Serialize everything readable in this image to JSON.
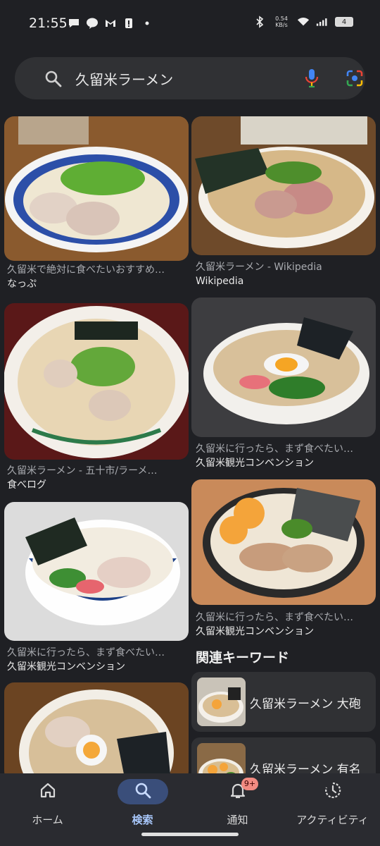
{
  "status": {
    "time": "21:55",
    "net_speed_value": "0.54",
    "net_speed_unit": "KB/s",
    "battery": "4",
    "left_icons": [
      "chat-icon",
      "line-icon",
      "gmail-icon",
      "alert-icon",
      "dot-icon"
    ],
    "right_icons": [
      "bluetooth-icon",
      "wifi-icon",
      "signal-icon",
      "battery-icon"
    ]
  },
  "search": {
    "query": "久留米ラーメン"
  },
  "results": [
    {
      "title": "久留米で絶対に食べたいおすすめ…",
      "source": "なっぷ"
    },
    {
      "title": "久留米ラーメン - Wikipedia",
      "source": "Wikipedia"
    },
    {
      "title": "久留米ラーメン - 五十市/ラーメ…",
      "source": "食べログ"
    },
    {
      "title": "久留米に行ったら、まず食べたい…",
      "source": "久留米観光コンベンション"
    },
    {
      "title": "久留米に行ったら、まず食べたい…",
      "source": "久留米観光コンベンション"
    },
    {
      "title": "久留米に行ったら、まず食べたい…",
      "source": "久留米観光コンベンション"
    }
  ],
  "related": {
    "title": "関連キーワード",
    "items": [
      {
        "label": "久留米ラーメン 大砲"
      },
      {
        "label": "久留米ラーメン 有名"
      }
    ]
  },
  "nav": {
    "items": [
      {
        "label": "ホーム",
        "icon": "home-icon"
      },
      {
        "label": "検索",
        "icon": "search-icon"
      },
      {
        "label": "通知",
        "icon": "bell-icon",
        "badge": "9+"
      },
      {
        "label": "アクティビティ",
        "icon": "activity-icon"
      }
    ],
    "active": "検索"
  }
}
